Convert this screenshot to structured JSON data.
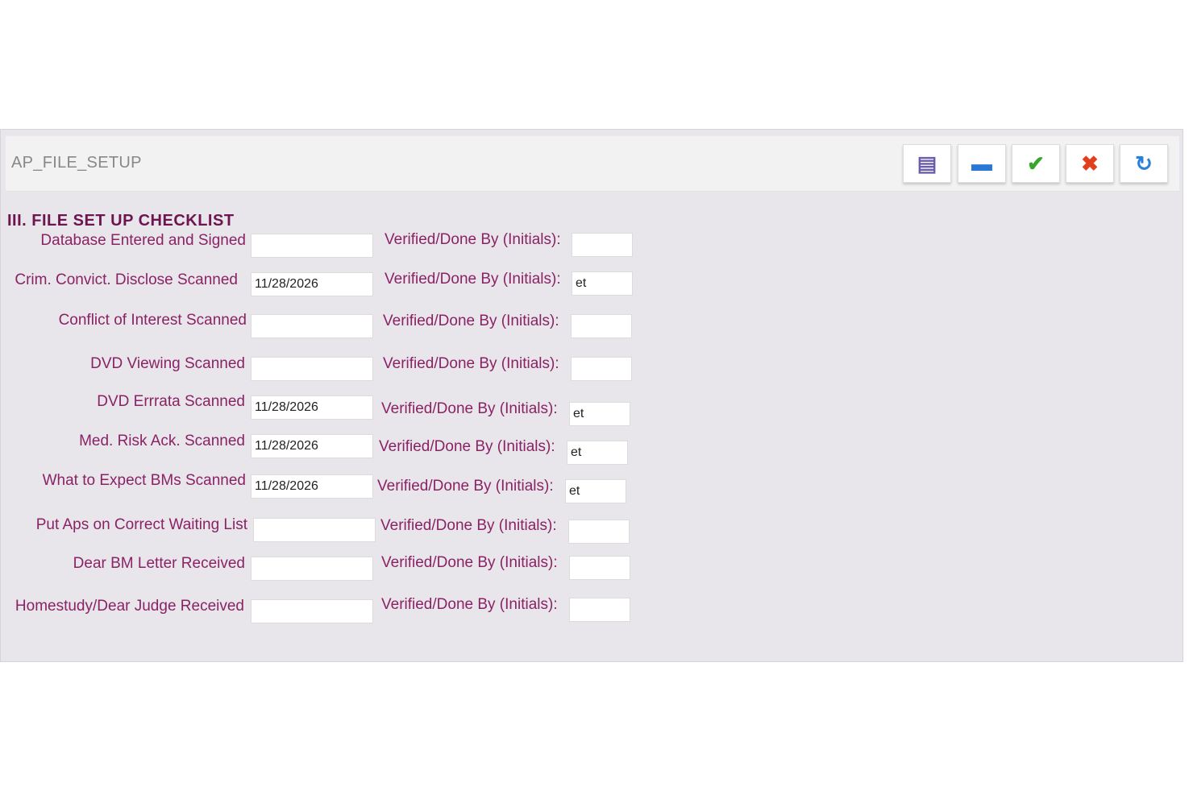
{
  "panel": {
    "title": "AP_FILE_SETUP",
    "toolbar": [
      {
        "icon": "notes-icon",
        "glyph": "▤",
        "color": "#6a5ca8"
      },
      {
        "icon": "minus-icon",
        "glyph": "▬",
        "color": "#2a78d6"
      },
      {
        "icon": "check-icon",
        "glyph": "✔",
        "color": "#3aa52c"
      },
      {
        "icon": "cancel-icon",
        "glyph": "✖",
        "color": "#e0401c"
      },
      {
        "icon": "refresh-icon",
        "glyph": "↻",
        "color": "#2a82d6"
      }
    ]
  },
  "section": {
    "title": "III. FILE SET UP CHECKLIST"
  },
  "verified_label": "Verified/Done By (Initials):",
  "rows": [
    {
      "label": "Database Entered and Signed",
      "date": "",
      "initials": ""
    },
    {
      "label": "Crim. Convict. Disclose Scanned",
      "date": "11/28/2026",
      "initials": "et"
    },
    {
      "label": "Conflict of Interest Scanned",
      "date": "",
      "initials": ""
    },
    {
      "label": "DVD Viewing Scanned",
      "date": "",
      "initials": ""
    },
    {
      "label": "DVD Errrata Scanned",
      "date": "11/28/2026",
      "initials": "et"
    },
    {
      "label": "Med. Risk Ack. Scanned",
      "date": "11/28/2026",
      "initials": "et"
    },
    {
      "label": "What to Expect BMs Scanned",
      "date": "11/28/2026",
      "initials": "et"
    },
    {
      "label": "Put Aps on Correct Waiting List",
      "date": "",
      "initials": ""
    },
    {
      "label": "Dear BM Letter Received",
      "date": "",
      "initials": ""
    },
    {
      "label": "Homestudy/Dear Judge Received",
      "date": "",
      "initials": ""
    }
  ]
}
